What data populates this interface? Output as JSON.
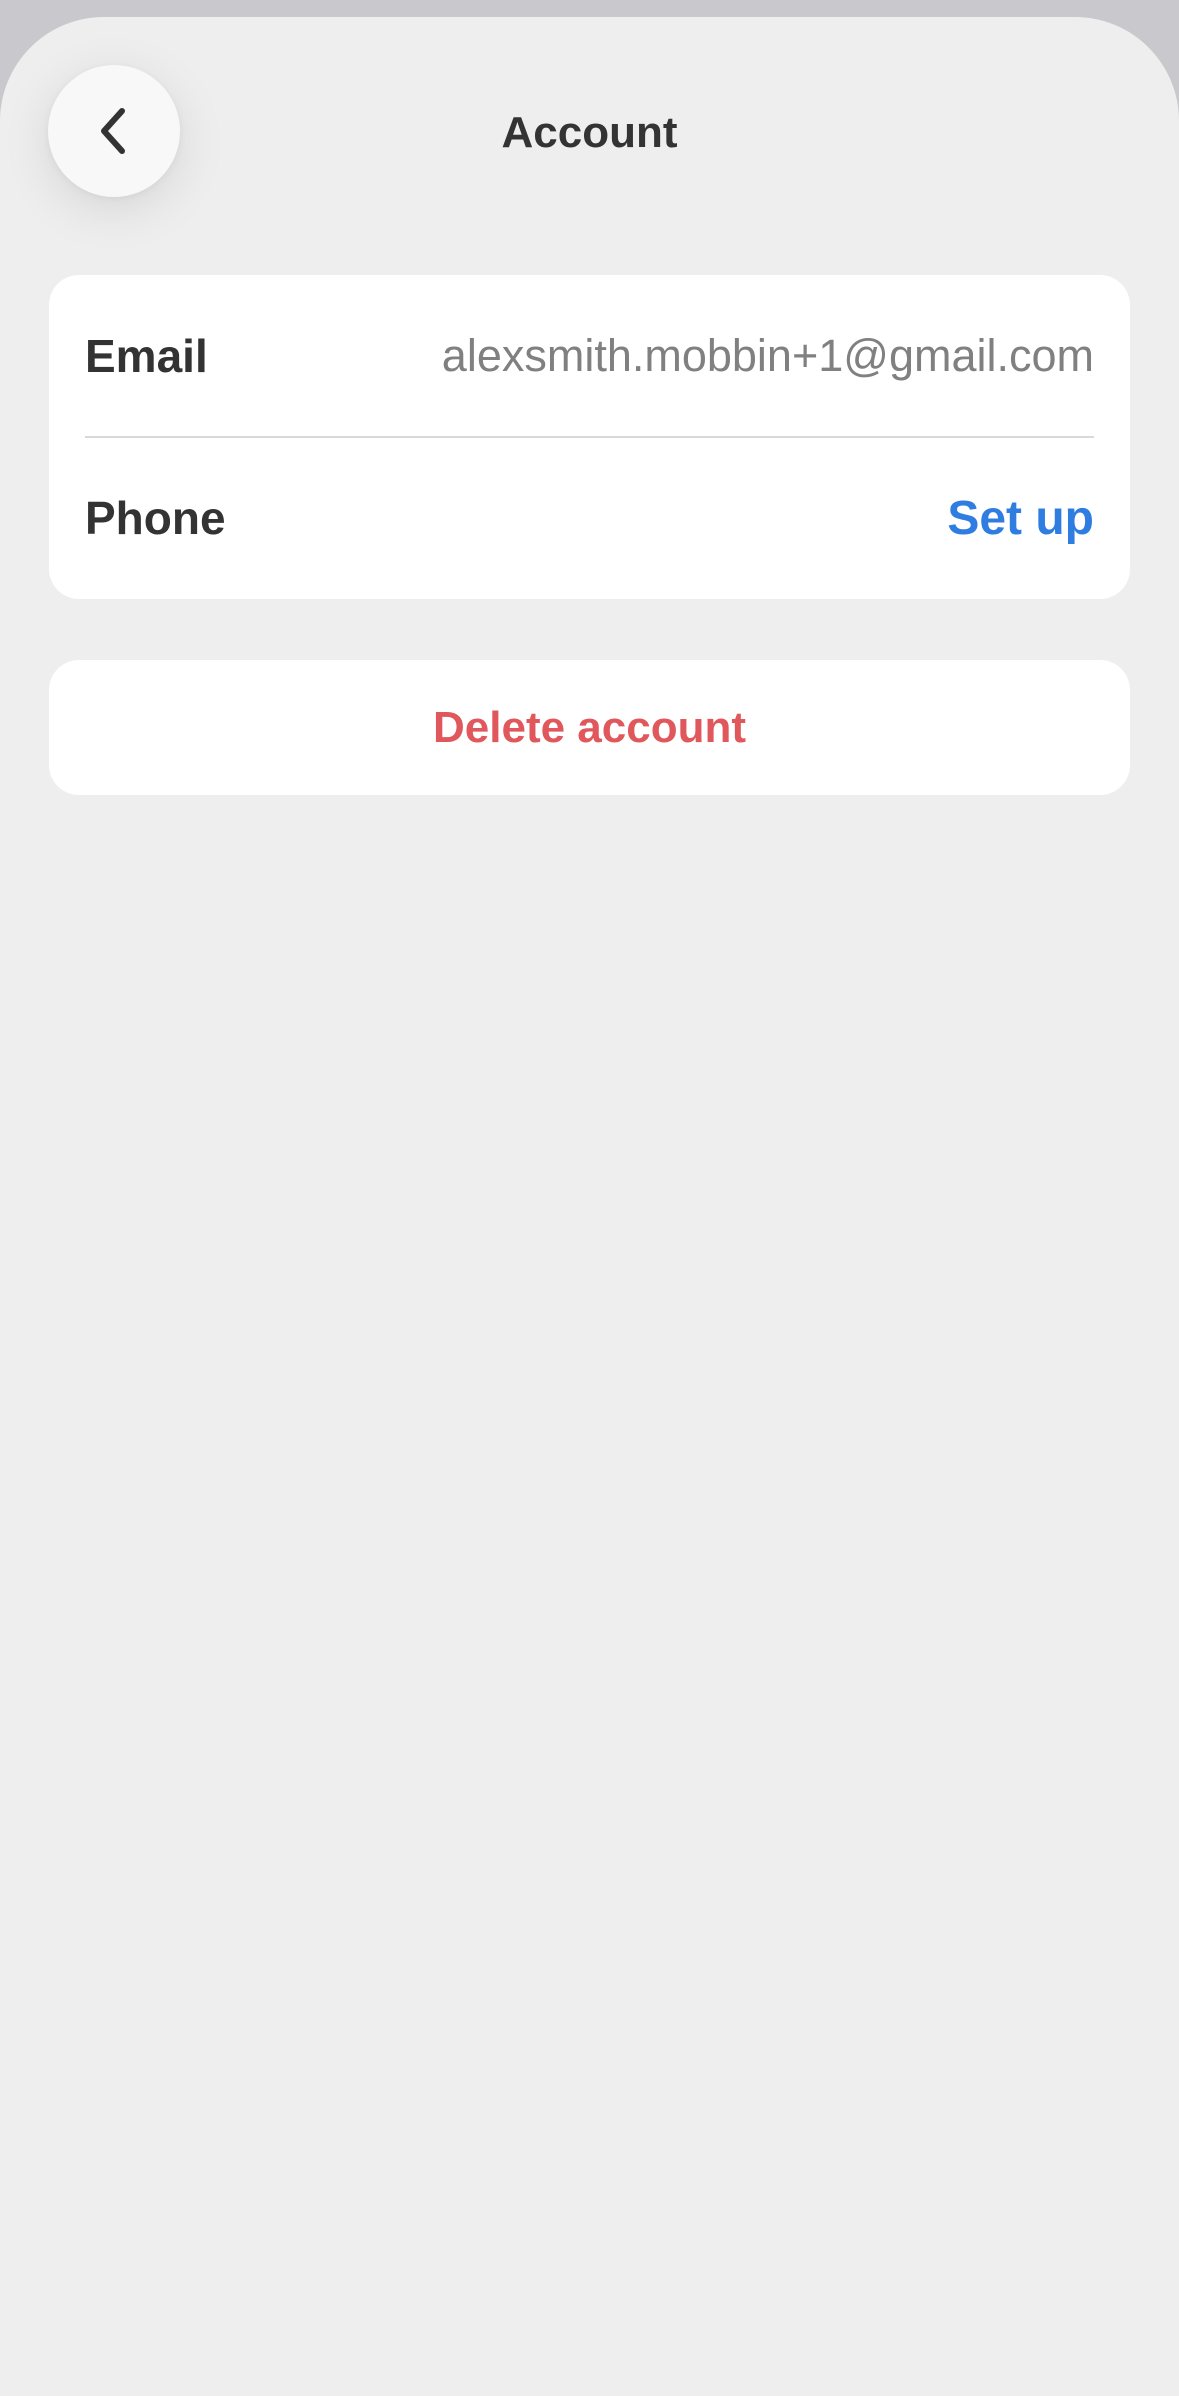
{
  "header": {
    "title": "Account",
    "back_icon": "chevron-left-icon"
  },
  "account": {
    "email_label": "Email",
    "email_value": "alexsmith.mobbin+1@gmail.com",
    "phone_label": "Phone",
    "phone_action": "Set up"
  },
  "delete": {
    "label": "Delete account"
  },
  "colors": {
    "background": "#eeeeee",
    "card": "#ffffff",
    "title_text": "#333333",
    "secondary_text": "#808080",
    "link": "#2f7de1",
    "destructive": "#e0575c"
  }
}
